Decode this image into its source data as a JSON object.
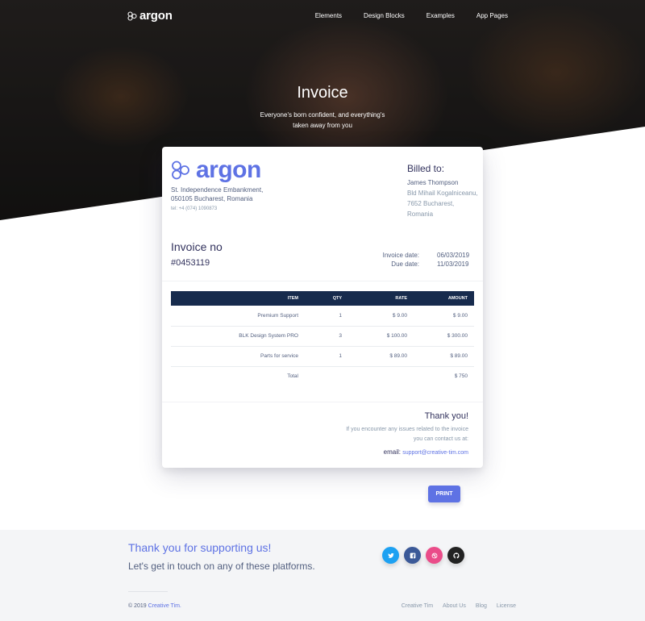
{
  "navbar": {
    "brand": "argon",
    "links": [
      "Elements",
      "Design Blocks",
      "Examples",
      "App Pages"
    ]
  },
  "hero": {
    "title": "Invoice",
    "subtitle": "Everyone's born confident, and everything's taken away from you"
  },
  "invoice": {
    "logo_text": "argon",
    "address_line1": "St. Independence Embankment,",
    "address_line2": "050105 Bucharest, Romania",
    "tel": "tel: +4 (074) 1090873",
    "billed_to_label": "Billed to:",
    "billed_name": "James Thompson",
    "billed_line1": "Bld Mihail Kogalniceanu,",
    "billed_line2": "7652 Bucharest,",
    "billed_line3": "Romania",
    "number_label": "Invoice no",
    "number": "#0453119",
    "invoice_date_label": "Invoice date:",
    "invoice_date": "06/03/2019",
    "due_date_label": "Due date:",
    "due_date": "11/03/2019",
    "table": {
      "headers": [
        "Item",
        "Qty",
        "Rate",
        "Amount"
      ],
      "rows": [
        [
          "Premium Support",
          "1",
          "$ 9.00",
          "$ 9.00"
        ],
        [
          "BLK Design System PRO",
          "3",
          "$ 100.00",
          "$ 300.00"
        ],
        [
          "Parts for service",
          "1",
          "$ 89.00",
          "$ 89.00"
        ]
      ],
      "total_label": "Total",
      "total": "$ 750"
    },
    "thanks": "Thank you!",
    "contact_text": "If you encounter any issues related to the invoice you can contact us at:",
    "email_label": "email:",
    "email": "support@creative-tim.com",
    "print_label": "PRINT"
  },
  "footer": {
    "title": "Thank you for supporting us!",
    "subtitle": "Let's get in touch on any of these platforms.",
    "socials": [
      {
        "icon": "twitter-icon",
        "color": "#1da1f2"
      },
      {
        "icon": "facebook-icon",
        "color": "#3b5998"
      },
      {
        "icon": "dribbble-icon",
        "color": "#ea4c89"
      },
      {
        "icon": "github-icon",
        "color": "#222222"
      }
    ],
    "copyright_prefix": "© 2019",
    "copyright_link": "Creative Tim.",
    "links": [
      "Creative Tim",
      "About Us",
      "Blog",
      "License"
    ]
  },
  "colors": {
    "primary": "#5e72e4",
    "table_header": "#172b4d"
  }
}
